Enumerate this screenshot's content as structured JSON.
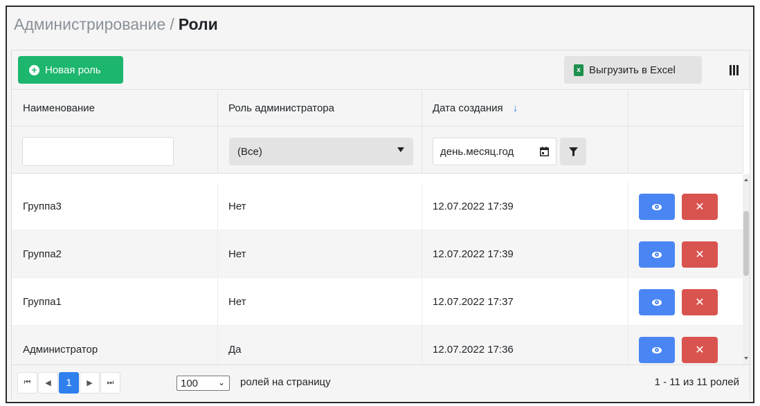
{
  "breadcrumb": {
    "parent": "Администрирование",
    "separator": "/",
    "current": "Роли"
  },
  "toolbar": {
    "new_role_label": "Новая роль",
    "export_label": "Выгрузить в Excel",
    "export_icon": "excel-icon",
    "column_chooser_icon": "columns-icon"
  },
  "columns": {
    "name": "Наименование",
    "admin_role": "Роль администратора",
    "created": "Дата создания",
    "sort_indicator": "↓"
  },
  "filters": {
    "name_value": "",
    "admin_role_value": "(Все)",
    "date_placeholder": "день.месяц.год"
  },
  "rows": [
    {
      "name": "Группа3",
      "admin": "Нет",
      "created": "12.07.2022 17:39"
    },
    {
      "name": "Группа2",
      "admin": "Нет",
      "created": "12.07.2022 17:39"
    },
    {
      "name": "Группа1",
      "admin": "Нет",
      "created": "12.07.2022 17:37"
    },
    {
      "name": "Администратор",
      "admin": "Да",
      "created": "12.07.2022 17:36"
    }
  ],
  "pager": {
    "current_page": "1",
    "page_size": "100",
    "per_page_label": "ролей на страницу",
    "info": "1 - 11 из 11 ролей"
  },
  "colors": {
    "primary_green": "#1db66e",
    "view_blue": "#4a86f3",
    "delete_red": "#d9534f",
    "active_page": "#2f80ed"
  }
}
